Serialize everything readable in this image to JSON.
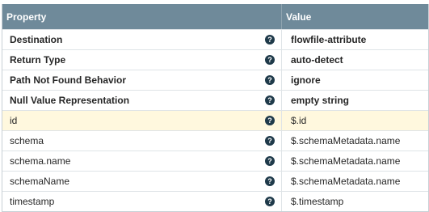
{
  "header": {
    "property": "Property",
    "value": "Value"
  },
  "help_glyph": "?",
  "rows": [
    {
      "name": "Destination",
      "value": "flowfile-attribute",
      "bold": true,
      "highlight": false
    },
    {
      "name": "Return Type",
      "value": "auto-detect",
      "bold": true,
      "highlight": false
    },
    {
      "name": "Path Not Found Behavior",
      "value": "ignore",
      "bold": true,
      "highlight": false
    },
    {
      "name": "Null Value Representation",
      "value": "empty string",
      "bold": true,
      "highlight": false
    },
    {
      "name": "id",
      "value": "$.id",
      "bold": false,
      "highlight": true
    },
    {
      "name": "schema",
      "value": "$.schemaMetadata.name",
      "bold": false,
      "highlight": false
    },
    {
      "name": "schema.name",
      "value": "$.schemaMetadata.name",
      "bold": false,
      "highlight": false
    },
    {
      "name": "schemaName",
      "value": "$.schemaMetadata.name",
      "bold": false,
      "highlight": false
    },
    {
      "name": "timestamp",
      "value": "$.timestamp",
      "bold": false,
      "highlight": false
    }
  ],
  "colors": {
    "header_bg": "#6f8a9a",
    "highlight_bg": "#fff8de",
    "help_icon_bg": "#1f3a4a"
  }
}
